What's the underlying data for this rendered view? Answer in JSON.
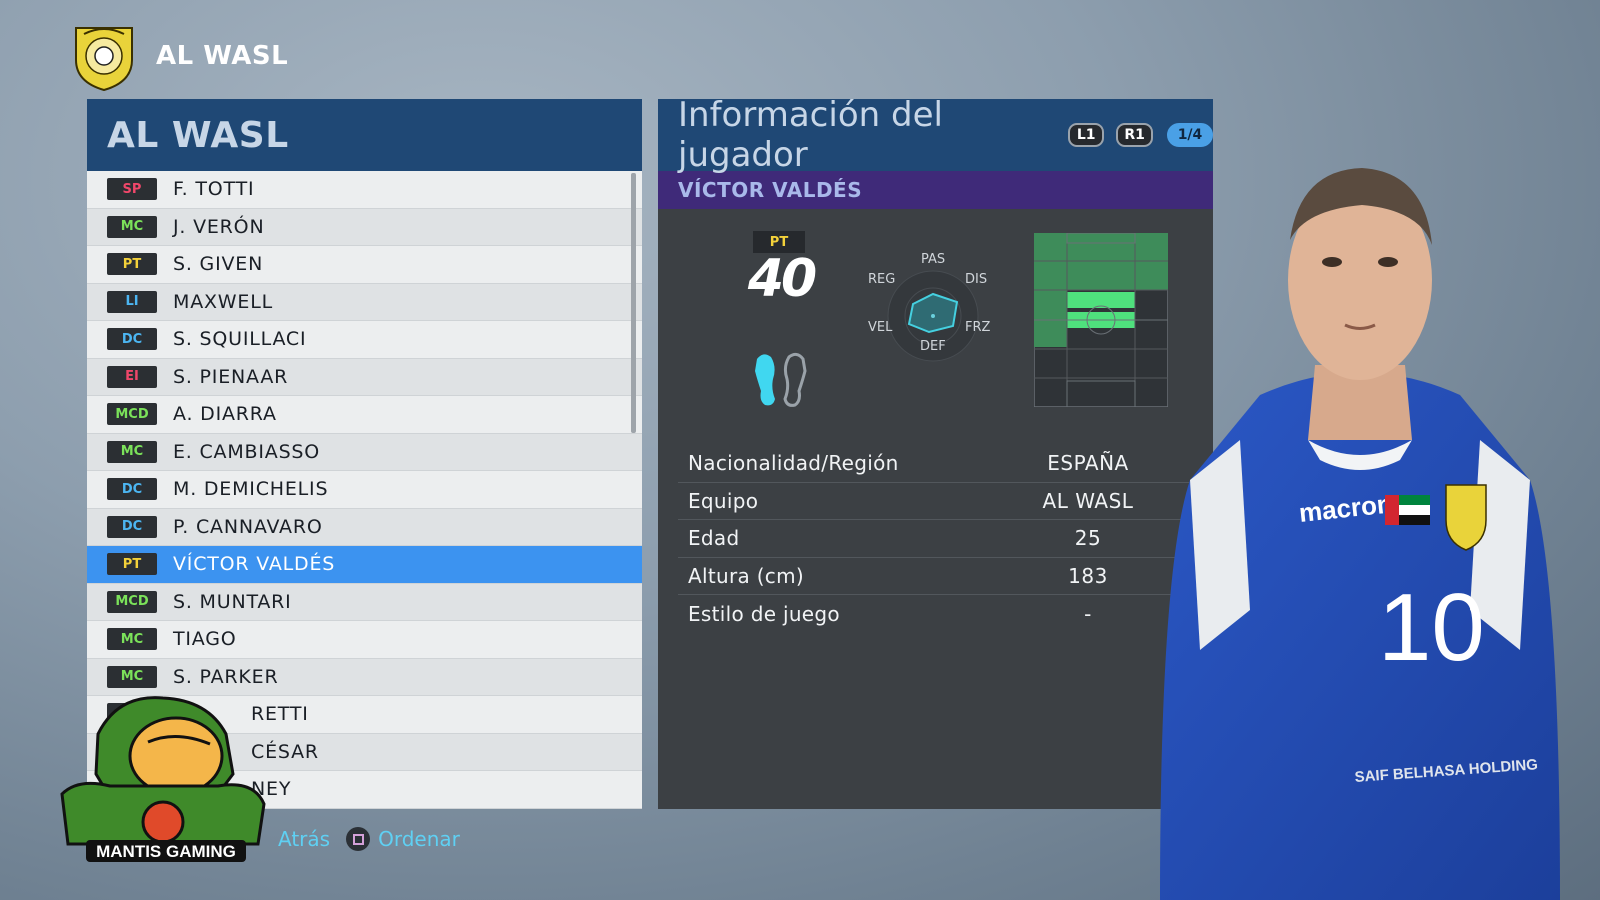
{
  "club": {
    "name": "AL WASL"
  },
  "squad": {
    "title": "AL WASL",
    "players": [
      {
        "pos": "SP",
        "name": "F. TOTTI",
        "pos_group": "att"
      },
      {
        "pos": "MC",
        "name": "J. VERÓN",
        "pos_group": "mid"
      },
      {
        "pos": "PT",
        "name": "S. GIVEN",
        "pos_group": "gk"
      },
      {
        "pos": "LI",
        "name": "MAXWELL",
        "pos_group": "def"
      },
      {
        "pos": "DC",
        "name": "S. SQUILLACI",
        "pos_group": "def"
      },
      {
        "pos": "EI",
        "name": "S. PIENAAR",
        "pos_group": "att"
      },
      {
        "pos": "MCD",
        "name": "A. DIARRA",
        "pos_group": "mid"
      },
      {
        "pos": "MC",
        "name": "E. CAMBIASSO",
        "pos_group": "mid"
      },
      {
        "pos": "DC",
        "name": "M. DEMICHELIS",
        "pos_group": "def"
      },
      {
        "pos": "DC",
        "name": "P. CANNAVARO",
        "pos_group": "def"
      },
      {
        "pos": "PT",
        "name": "VÍCTOR VALDÉS",
        "pos_group": "gk",
        "selected": true
      },
      {
        "pos": "MCD",
        "name": "S. MUNTARI",
        "pos_group": "mid"
      },
      {
        "pos": "MC",
        "name": "TIAGO",
        "pos_group": "mid"
      },
      {
        "pos": "MC",
        "name": "S. PARKER",
        "pos_group": "mid"
      },
      {
        "pos": "",
        "name": "RETTI",
        "pos_group": "mid"
      },
      {
        "pos": "",
        "name": "CÉSAR",
        "pos_group": "gk"
      },
      {
        "pos": "",
        "name": "NEY",
        "pos_group": "att"
      }
    ]
  },
  "info": {
    "title": "Información del jugador",
    "l1": "L1",
    "r1": "R1",
    "page": "1/4",
    "player_name": "VÍCTOR VALDÉS",
    "position": "PT",
    "overall": "40",
    "preferred_foot": "left",
    "radar_labels": {
      "pas": "PAS",
      "reg": "REG",
      "dis": "DIS",
      "vel": "VEL",
      "frz": "FRZ",
      "def": "DEF"
    },
    "rows": [
      {
        "label": "Nacionalidad/Región",
        "value": "ESPAÑA"
      },
      {
        "label": "Equipo",
        "value": "AL WASL"
      },
      {
        "label": "Edad",
        "value": "25"
      },
      {
        "label": "Altura (cm)",
        "value": "183"
      },
      {
        "label": "Estilo de juego",
        "value": "-"
      }
    ]
  },
  "footer": {
    "back": "Atrás",
    "sort": "Ordenar"
  },
  "watermark": {
    "text": "MANTIS GAMING"
  },
  "kit": {
    "brand": "macron",
    "number": "10",
    "sponsor": "SAIF BELHASA HOLDING"
  },
  "colors": {
    "panel_header": "#1f4875",
    "selected_row": "#3c93f0",
    "name_bar": "#3f2a79"
  }
}
